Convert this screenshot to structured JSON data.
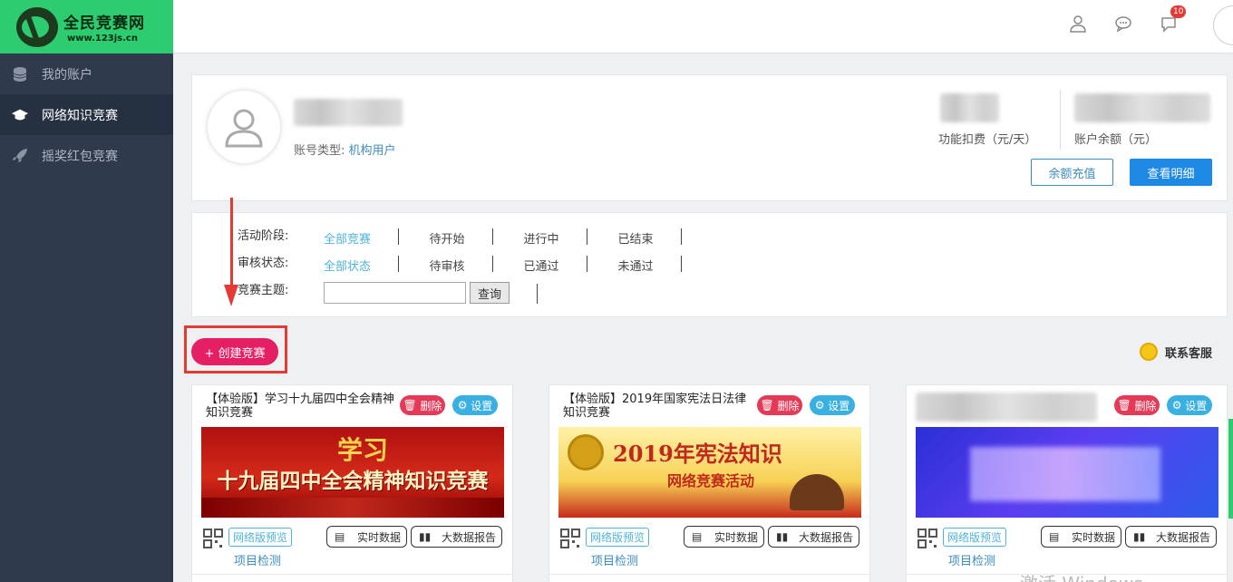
{
  "brand": {
    "title": "全民竞赛网",
    "url": "www.123js.cn"
  },
  "sidebar": {
    "items": [
      {
        "label": "我的账户",
        "icon": "database-icon",
        "active": false
      },
      {
        "label": "网络知识竞赛",
        "icon": "graduation-cap-icon",
        "active": true
      },
      {
        "label": "摇奖红包竞赛",
        "icon": "rocket-icon",
        "active": false
      }
    ]
  },
  "topbar": {
    "notification_count": "10"
  },
  "profile": {
    "account_type_label": "账号类型: ",
    "account_type_value": "机构用户",
    "fee_label": "功能扣费（元/天）",
    "balance_label": "账户余额（元）",
    "recharge_label": "余额充值",
    "detail_label": "查看明细"
  },
  "filters": {
    "stage_label": "活动阶段:",
    "stage_options": [
      "全部竞赛",
      "待开始",
      "进行中",
      "已结束"
    ],
    "review_label": "审核状态:",
    "review_options": [
      "全部状态",
      "待审核",
      "已通过",
      "未通过"
    ],
    "topic_label": "竞赛主题:",
    "topic_value": "",
    "search_label": "查询"
  },
  "actions": {
    "create_label": "+ 创建竞赛",
    "service_label": "联系客服"
  },
  "cards": [
    {
      "title": "【体验版】学习十九届四中全会精神知识竞赛",
      "delete": "删除",
      "settings": "设置",
      "banner_main": "十九届四中全会精神知识竞赛",
      "banner_top": "学习",
      "preview": "网络版预览",
      "realtime": "实时数据",
      "report": "大数据报告",
      "check": "项目检测"
    },
    {
      "title": "【体验版】2019年国家宪法日法律知识竞赛",
      "delete": "删除",
      "settings": "设置",
      "banner_main": "2019年宪法知识",
      "banner_top": "网络竞赛活动",
      "preview": "网络版预览",
      "realtime": "实时数据",
      "report": "大数据报告",
      "check": "项目检测"
    },
    {
      "title": "",
      "delete": "删除",
      "settings": "设置",
      "banner_main": "",
      "banner_top": "",
      "preview": "网络版预览",
      "realtime": "实时数据",
      "report": "大数据报告",
      "check": "项目检测"
    }
  ],
  "watermark": "激活 Windows"
}
